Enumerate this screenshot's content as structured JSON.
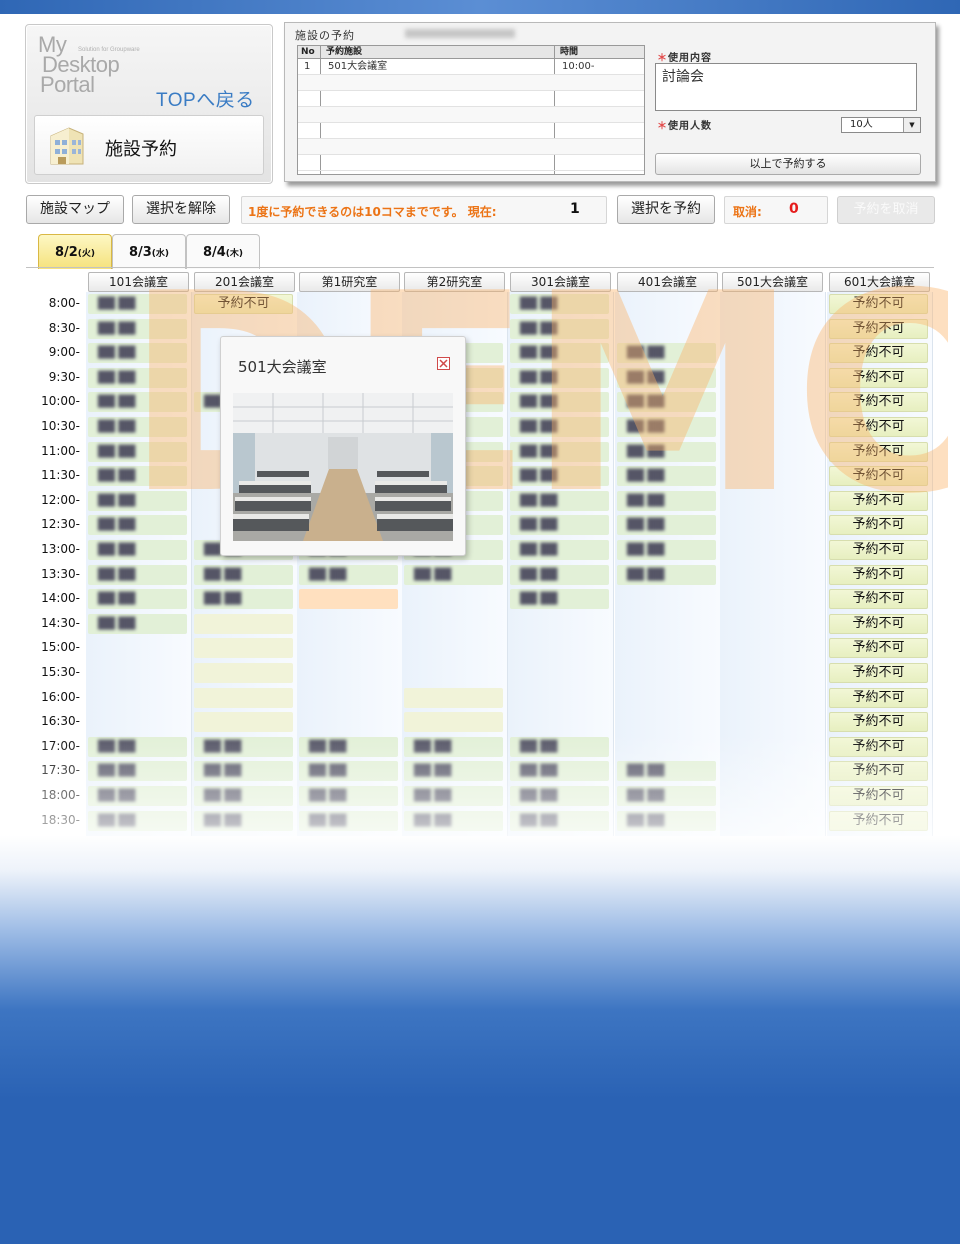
{
  "logo": {
    "line1": "My",
    "line2": "Desktop",
    "line3": "Portal",
    "tagline": "Solution for Groupware"
  },
  "nav": {
    "top_link": "TOPへ戻る"
  },
  "section_title": "施設予約",
  "reservation": {
    "title": "施設の予約",
    "columns": {
      "no": "No",
      "facility": "予約施設",
      "time": "時間"
    },
    "rows": [
      {
        "no": "1",
        "facility": "501大会議室",
        "time": "10:00-"
      }
    ],
    "usage_label": "使用内容",
    "usage_value": "討論会",
    "people_label": "使用人数",
    "people_value": "10人",
    "submit_label": "以上で予約する",
    "required_mark": "＊"
  },
  "toolbar": {
    "map_label": "施設マップ",
    "clear_label": "選択を解除",
    "notice": "1度に予約できるのは10コマまでです。 現在:",
    "current_count": "1",
    "reserve_label": "選択を予約",
    "cancel_label": "取消:",
    "cancel_count": "0",
    "cancel_reserve_label": "予約を取消"
  },
  "dates": [
    {
      "label": "8/2",
      "dow": "(火)",
      "active": true
    },
    {
      "label": "8/3",
      "dow": "(水)",
      "active": false
    },
    {
      "label": "8/4",
      "dow": "(木)",
      "active": false
    }
  ],
  "rooms": [
    "101会議室",
    "201会議室",
    "第1研究室",
    "第2研究室",
    "301会議室",
    "401会議室",
    "501大会議室",
    "601大会議室"
  ],
  "times": [
    "8:00-",
    "8:30-",
    "9:00-",
    "9:30-",
    "10:00-",
    "10:30-",
    "11:00-",
    "11:30-",
    "12:00-",
    "12:30-",
    "13:00-",
    "13:30-",
    "14:00-",
    "14:30-",
    "15:00-",
    "15:30-",
    "16:00-",
    "16:30-",
    "17:00-",
    "17:30-",
    "18:00-",
    "18:30-"
  ],
  "unavailable_text": "予約不可",
  "popup": {
    "title": "501大会議室"
  },
  "watermark": "DEMO",
  "colors": {
    "accent_orange": "#ec7416",
    "count_red": "#e51c1c",
    "link_blue": "#3a7cc4",
    "slot_green": "#e2f0d7",
    "slot_selected": "#ffe0bf"
  }
}
